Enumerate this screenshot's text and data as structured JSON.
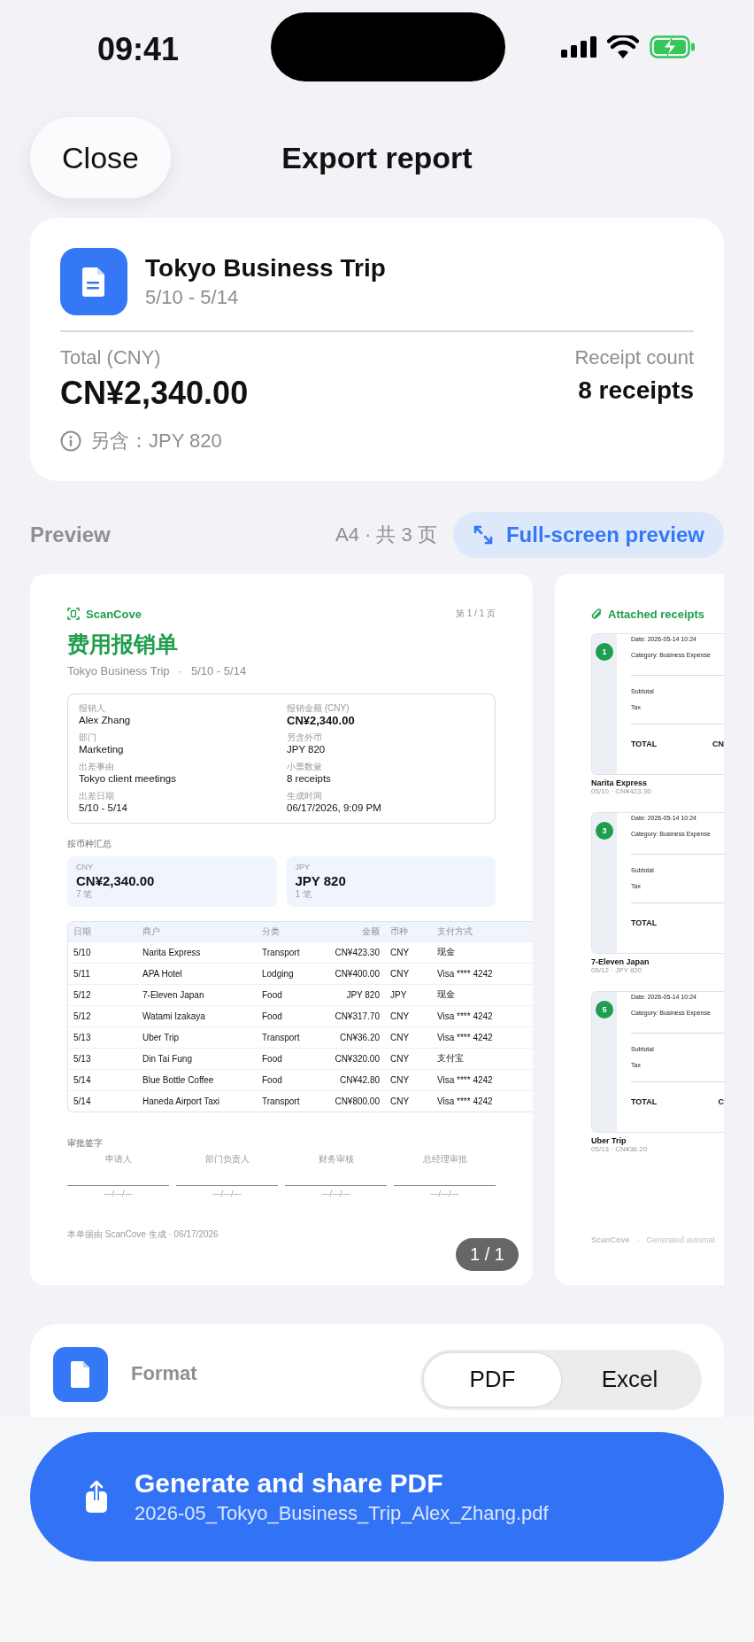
{
  "status_bar": {
    "time": "09:41"
  },
  "header": {
    "close_button": "Close",
    "title": "Export report"
  },
  "summary": {
    "title": "Tokyo Business Trip",
    "dates": "5/10 - 5/14",
    "total_label": "Total (CNY)",
    "total": "CN¥2,340.00",
    "count_label": "Receipt count",
    "count": "8 receipts",
    "note": "另含：JPY 820"
  },
  "preview": {
    "label": "Preview",
    "page_info": "A4 · 共 3 页",
    "fullscreen_button": "Full-screen preview",
    "report_page": {
      "brand": "ScanCove",
      "page_number": "第 1 / 1 页",
      "title": "费用报销单",
      "trip": "Tokyo Business Trip",
      "separator": "·",
      "dates": "5/10 - 5/14",
      "info_fields": [
        {
          "label": "报销人",
          "value": "Alex Zhang",
          "kind": "text"
        },
        {
          "label": "报销金额 (CNY)",
          "value": "CN¥2,340.00",
          "kind": "amount"
        },
        {
          "label": "部门",
          "value": "Marketing",
          "kind": "text"
        },
        {
          "label": "另含外币",
          "value": "JPY 820",
          "kind": "text"
        },
        {
          "label": "出差事由",
          "value": "Tokyo client meetings",
          "kind": "text"
        },
        {
          "label": "小票数量",
          "value": "8 receipts",
          "kind": "text"
        },
        {
          "label": "出差日期",
          "value": "5/10 - 5/14",
          "kind": "text"
        },
        {
          "label": "生成时间",
          "value": "06/17/2026, 9:09 PM",
          "kind": "text"
        }
      ],
      "currency_summary_label": "按币种汇总",
      "currency_cards": [
        {
          "currency": "CNY",
          "amount": "CN¥2,340.00",
          "count": "7 笔"
        },
        {
          "currency": "JPY",
          "amount": "JPY 820",
          "count": "1 笔"
        }
      ],
      "table": {
        "columns": [
          "日期",
          "商户",
          "分类",
          "金额",
          "币种",
          "支付方式"
        ],
        "rows": [
          [
            "5/10",
            "Narita Express",
            "Transport",
            "CN¥423.30",
            "CNY",
            "现金"
          ],
          [
            "5/11",
            "APA Hotel",
            "Lodging",
            "CN¥400.00",
            "CNY",
            "Visa **** 4242"
          ],
          [
            "5/12",
            "7-Eleven Japan",
            "Food",
            "JPY 820",
            "JPY",
            "现金"
          ],
          [
            "5/12",
            "Watami Izakaya",
            "Food",
            "CN¥317.70",
            "CNY",
            "Visa **** 4242"
          ],
          [
            "5/13",
            "Uber Trip",
            "Transport",
            "CN¥36.20",
            "CNY",
            "Visa **** 4242"
          ],
          [
            "5/13",
            "Din Tai Fung",
            "Food",
            "CN¥320.00",
            "CNY",
            "支付宝"
          ],
          [
            "5/14",
            "Blue Bottle Coffee",
            "Food",
            "CN¥42.80",
            "CNY",
            "Visa **** 4242"
          ],
          [
            "5/14",
            "Haneda Airport Taxi",
            "Transport",
            "CN¥800.00",
            "CNY",
            "Visa **** 4242"
          ]
        ]
      },
      "signature_label": "审批签字",
      "signatures": [
        {
          "role": "申请人",
          "date": "—/—/—"
        },
        {
          "role": "部门负责人",
          "date": "—/—/—"
        },
        {
          "role": "财务审核",
          "date": "—/—/—"
        },
        {
          "role": "总经理审批",
          "date": "—/—/—"
        }
      ],
      "footer": "本单据由 ScanCove 生成 · 06/17/2026"
    },
    "page_badge": "1 / 1",
    "receipts_page": {
      "title": "Attached receipts",
      "receipts": [
        {
          "number": "1",
          "date_line": "Date: 2026-05-14 10:24",
          "category_line": "Category: Business Expense",
          "subtotal_label": "Subtotal",
          "tax_label": "Tax",
          "total_label": "TOTAL",
          "total_value": "CN",
          "merchant": "Narita Express",
          "meta": "05/10 · CN¥423.30"
        },
        {
          "number": "3",
          "date_line": "Date: 2026-05-14 10:24",
          "category_line": "Category: Business Expense",
          "subtotal_label": "Subtotal",
          "tax_label": "Tax",
          "total_label": "TOTAL",
          "merchant": "7-Eleven Japan",
          "meta": "05/12 · JPY 820"
        },
        {
          "number": "5",
          "date_line": "Date: 2026-05-14 10:24",
          "category_line": "Category: Business Expense",
          "subtotal_label": "Subtotal",
          "tax_label": "Tax",
          "total_label": "TOTAL",
          "total_value": "C",
          "merchant": "Uber Trip",
          "meta": "05/13 · CN¥36.20"
        }
      ],
      "footer_brand": "ScanCove",
      "footer_separator": "·",
      "footer_text": "Generated automat"
    }
  },
  "format": {
    "label": "Format",
    "options": [
      {
        "label": "PDF",
        "selected": true
      },
      {
        "label": "Excel",
        "selected": false
      }
    ]
  },
  "generate_button": {
    "title": "Generate and share PDF",
    "filename": "2026-05_Tokyo_Business_Trip_Alex_Zhang.pdf"
  }
}
